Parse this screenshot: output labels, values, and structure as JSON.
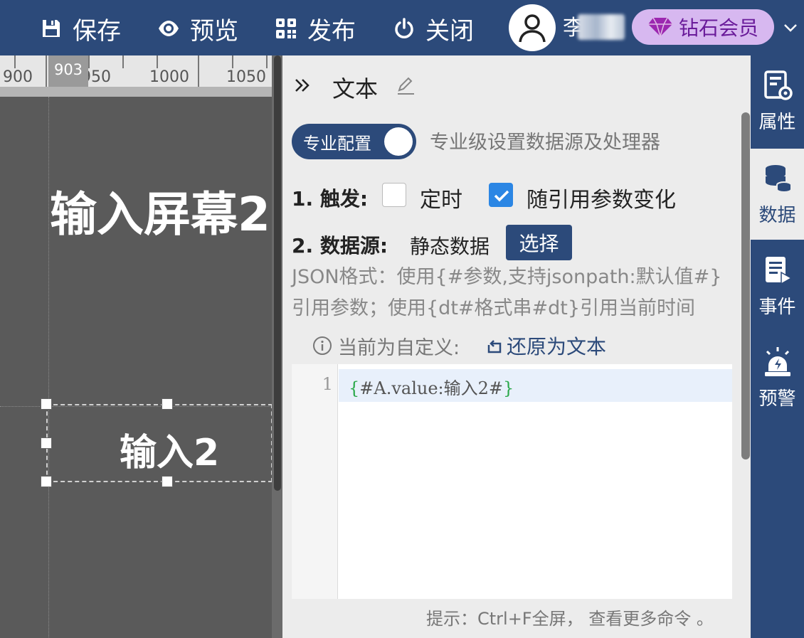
{
  "topbar": {
    "buttons": [
      {
        "label": "保存",
        "icon": "save-icon"
      },
      {
        "label": "预览",
        "icon": "eye-icon"
      },
      {
        "label": "发布",
        "icon": "qrcode-icon"
      },
      {
        "label": "关闭",
        "icon": "power-icon"
      }
    ],
    "username": "李",
    "vip_label": "钻石会员",
    "colors": {
      "bar": "#2c4a7a",
      "vip_bg": "#d7b8f0",
      "vip_text": "#6a1b9a"
    }
  },
  "canvas": {
    "ruler": {
      "ticks": [
        "900",
        "950",
        "1000",
        "1050"
      ],
      "marker": "903"
    },
    "screen_title": "输入屏幕2",
    "selected_text": "输入2"
  },
  "panel": {
    "title": "文本",
    "toggle_label": "专业配置",
    "toggle_desc": "专业级设置数据源及处理器",
    "trigger": {
      "label": "1. 触发:",
      "options": [
        {
          "label": "定时",
          "checked": false
        },
        {
          "label": "随引用参数变化",
          "checked": true
        }
      ]
    },
    "datasource": {
      "label": "2. 数据源:",
      "value": "静态数据",
      "select_button": "选择"
    },
    "help_text": "JSON格式：使用{#参数,支持jsonpath:默认值#}引用参数；使用{dt#格式串#dt}引用当前时间",
    "info_text": "当前为自定义:",
    "restore_link": "还原为文本",
    "editor": {
      "line_number": "1",
      "code_open": "{",
      "code_body": "#A.value:输入2#",
      "code_close": "}"
    },
    "hint": "提示：Ctrl+F全屏， 查看更多命令 。"
  },
  "sidetabs": [
    {
      "label": "属性",
      "icon": "property-settings-icon",
      "active": false
    },
    {
      "label": "数据",
      "icon": "database-icon",
      "active": true
    },
    {
      "label": "事件",
      "icon": "event-document-icon",
      "active": false
    },
    {
      "label": "预警",
      "icon": "alarm-light-icon",
      "active": false
    }
  ]
}
